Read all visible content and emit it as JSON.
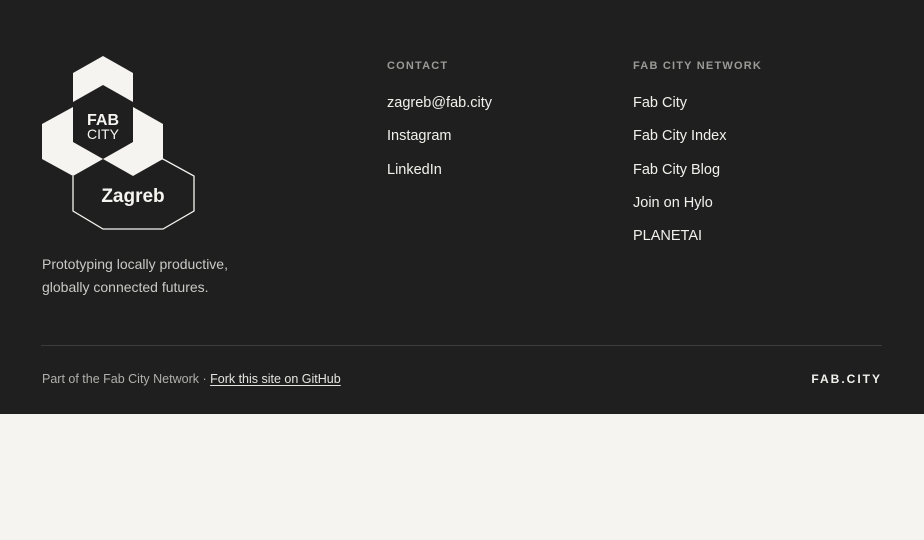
{
  "logo": {
    "line1": "FAB",
    "line2": "CITY",
    "city": "Zagreb"
  },
  "tagline": {
    "line1": "Prototyping locally productive,",
    "line2": "globally connected futures."
  },
  "contact": {
    "heading": "CONTACT",
    "links": [
      "zagreb@fab.city",
      "Instagram",
      "LinkedIn"
    ]
  },
  "network": {
    "heading": "FAB CITY NETWORK",
    "links": [
      "Fab City",
      "Fab City Index",
      "Fab City Blog",
      "Join on Hylo",
      "PLANETAI"
    ]
  },
  "bottom": {
    "prefix": "Part of the Fab City Network · ",
    "github_link": "Fork this site on GitHub",
    "wordmark": "FAB.CITY"
  },
  "colors": {
    "footer_bg": "#1f1f1f",
    "page_bg": "#f5f4f0",
    "text_light": "#f1f1ec"
  }
}
